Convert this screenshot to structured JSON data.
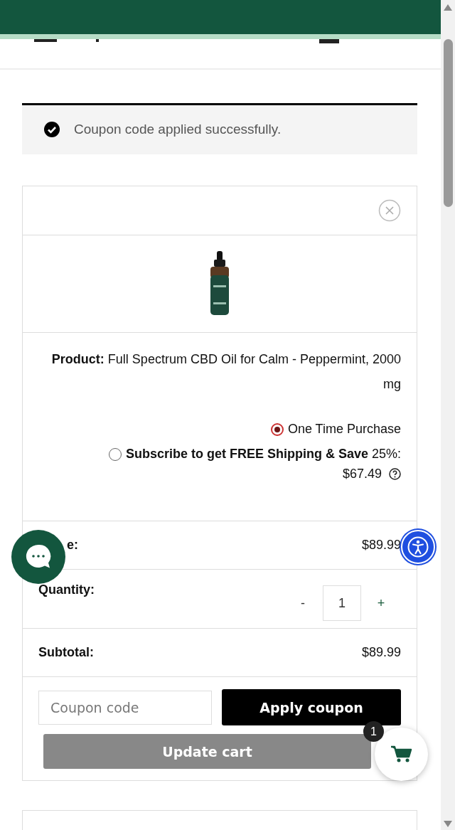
{
  "notice": {
    "text": "Coupon code applied successfully."
  },
  "cart_item": {
    "product_text": "**Product:** Full Spectrum CBD Oil for Calm - Peppermint, 2000 mg",
    "purchase_options": [
      {
        "label": "One Time Purchase",
        "selected": true
      },
      {
        "label": "**Subscribe to get FREE Shipping & Save** 25%:",
        "selected": false
      }
    ],
    "subscribe_price": "$67.49",
    "price": {
      "label": "e:",
      "value": "$89.99"
    },
    "quantity": {
      "label": "Quantity:",
      "minus": "-",
      "value": "1",
      "plus": "+"
    },
    "subtotal": {
      "label": "Subtotal:",
      "value": "$89.99"
    }
  },
  "coupon": {
    "placeholder": "Coupon code",
    "apply": "Apply coupon"
  },
  "update_button": {
    "label": "Update cart",
    "disabled": true
  },
  "cart_badge": "1"
}
